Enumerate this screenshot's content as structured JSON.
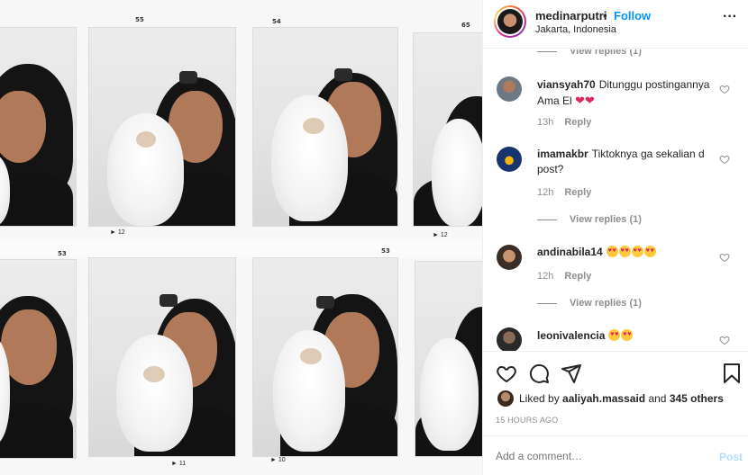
{
  "post": {
    "media": {
      "frame_numbers": [
        "55",
        "54",
        "65",
        "53",
        "53"
      ],
      "arrow_labels": [
        "12",
        "12",
        "11",
        "10"
      ]
    },
    "header": {
      "username": "medinarputri",
      "separator": "•",
      "follow_label": "Follow",
      "location": "Jakarta, Indonesia",
      "more_label": "···"
    },
    "comments": [
      {
        "type": "view_replies",
        "label": "View replies (1)"
      },
      {
        "user": "viansyah70",
        "text": "Ditunggu postingannya Ama El",
        "emoji": "❤❤",
        "time": "13h",
        "reply_label": "Reply"
      },
      {
        "user": "imamakbr",
        "text": "Tiktoknya ga sekalian d post?",
        "time": "12h",
        "reply_label": "Reply",
        "view_replies": "View replies (1)"
      },
      {
        "user": "andinabila14",
        "text": "",
        "emoji_count": 4,
        "time": "12h",
        "reply_label": "Reply",
        "view_replies": "View replies (1)"
      },
      {
        "user": "leonivalencia",
        "text": "",
        "emoji_count": 2
      }
    ],
    "likes": {
      "prefix": "Liked by",
      "user": "aaliyah.massaid",
      "and_label": "and",
      "others": "345 others"
    },
    "time_ago": "15 HOURS AGO",
    "add_comment": {
      "placeholder": "Add a comment…",
      "post_label": "Post"
    },
    "icons": [
      "like-icon",
      "comment-icon",
      "share-icon",
      "save-icon",
      "heart-outline-icon"
    ],
    "colors": {
      "accent": "#0095f6",
      "muted": "#8e8e8e",
      "post_disabled": "#b2dffc",
      "heart": "#e0245e"
    }
  }
}
